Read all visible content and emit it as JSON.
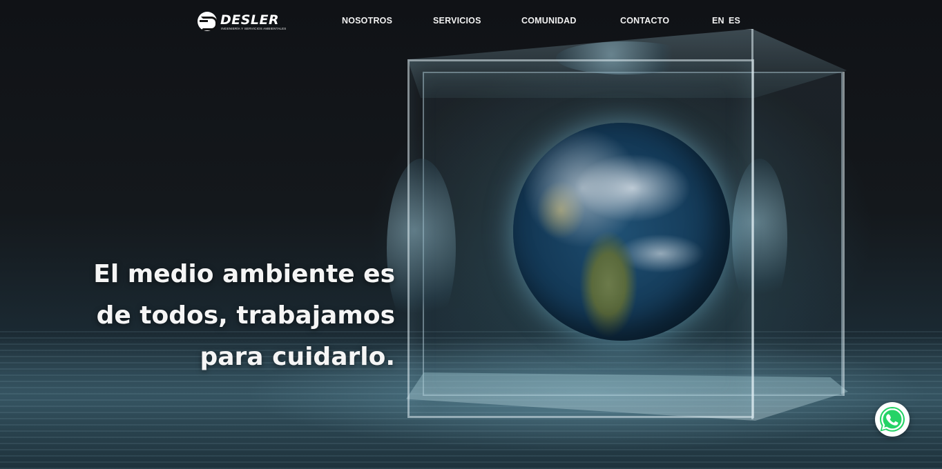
{
  "brand": {
    "name": "DESLER",
    "tagline": "INGENIERÍA Y SERVICIOS AMBIENTALES",
    "logo_icon": "desler-logo-icon"
  },
  "nav": {
    "items": [
      {
        "label": "NOSOTROS"
      },
      {
        "label": "SERVICIOS"
      },
      {
        "label": "COMUNIDAD"
      },
      {
        "label": "CONTACTO"
      }
    ],
    "languages": [
      {
        "label": "EN"
      },
      {
        "label": "ES"
      }
    ]
  },
  "hero": {
    "headline_lines": [
      "El medio ambiente es",
      "de todos, trabajamos",
      "para cuidarlo."
    ],
    "image_subject": "earth-globe-in-glass-cube"
  },
  "floating": {
    "whatsapp_icon": "whatsapp-icon"
  },
  "colors": {
    "background": "#0d0f12",
    "text": "#ffffff",
    "whatsapp_green": "#25d366"
  }
}
